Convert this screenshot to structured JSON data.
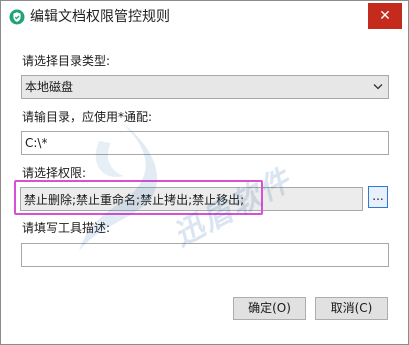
{
  "window": {
    "title": "编辑文档权限管控规则",
    "close_glyph": "✕"
  },
  "form": {
    "directory_type_label": "请选择目录类型:",
    "directory_type_value": "本地磁盘",
    "directory_label": "请输目录，应使用*通配:",
    "directory_value": "C:\\*",
    "permission_label": "请选择权限:",
    "permission_value": "禁止删除;禁止重命名;禁止拷出;禁止移出;",
    "browse_label": "...",
    "description_label": "请填写工具描述:",
    "description_value": ""
  },
  "watermark": {
    "text": "迅盾软件"
  },
  "buttons": {
    "ok_label": "确定(O)",
    "cancel_label": "取消(C)"
  },
  "colors": {
    "close_button": "#c42b1c",
    "highlight_border": "#d94fd6",
    "browse_border": "#2b79d0",
    "watermark": "#3470b4"
  },
  "icons": {
    "app": "app-shield-icon",
    "close": "close-icon",
    "dropdown": "chevron-down-icon"
  }
}
